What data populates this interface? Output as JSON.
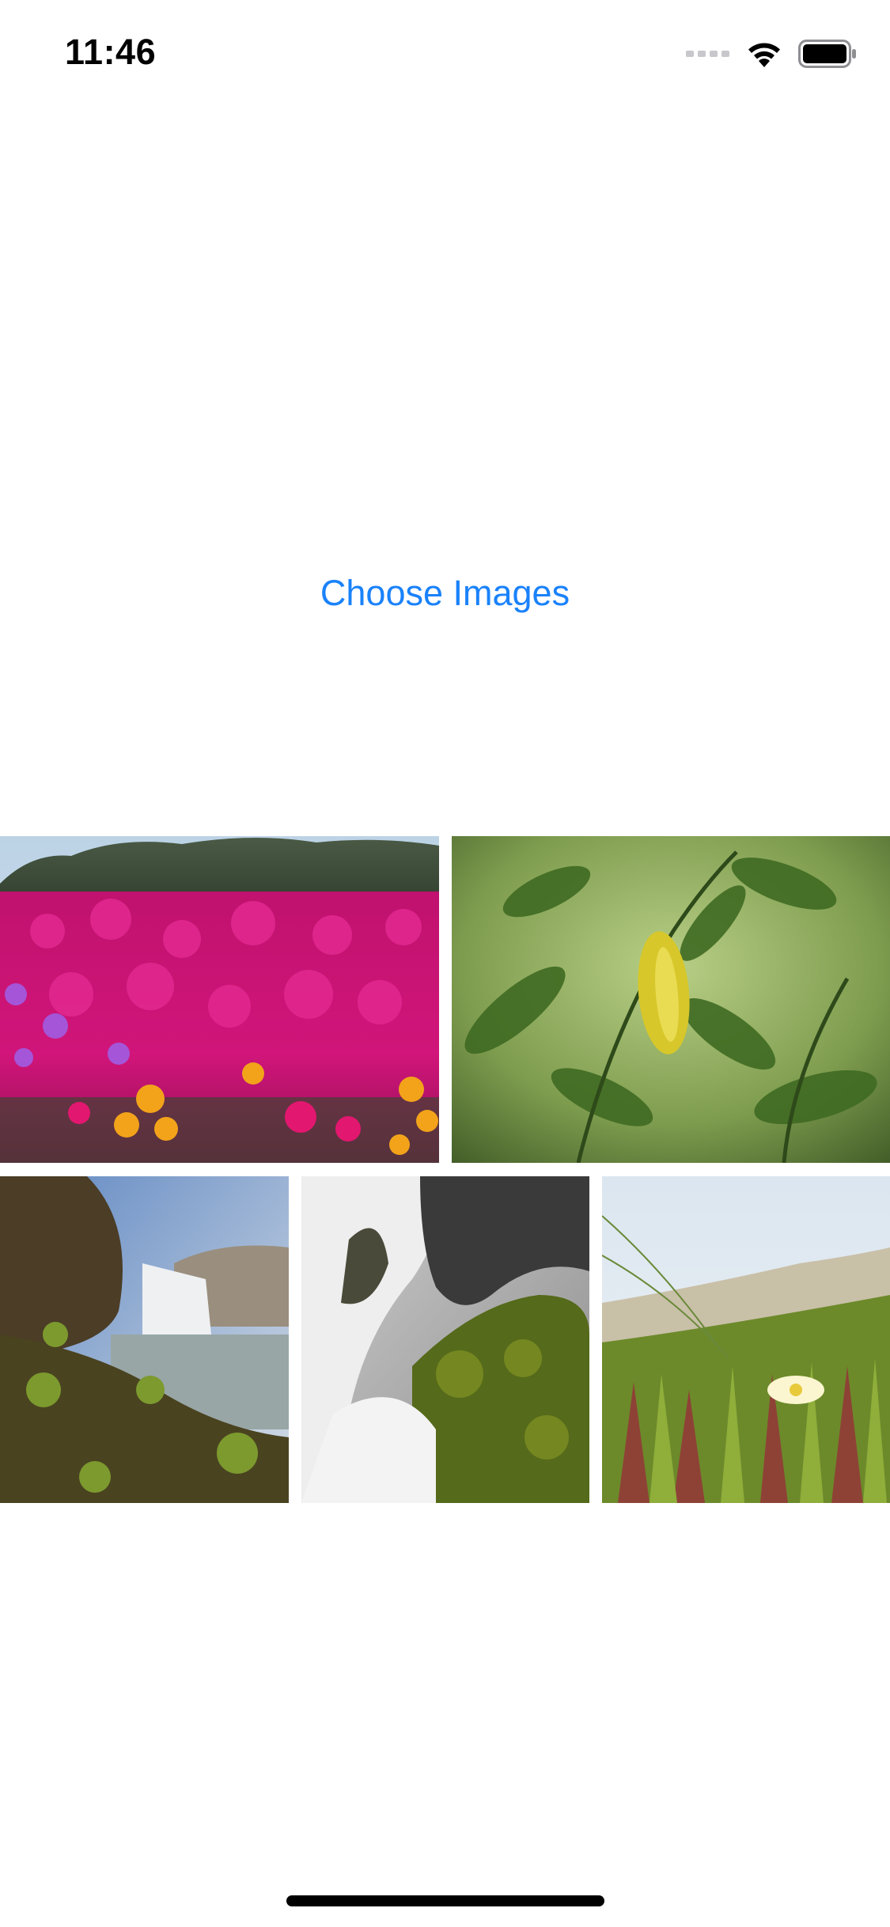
{
  "status_bar": {
    "time": "11:46",
    "icons": [
      "signal-icon",
      "wifi-icon",
      "battery-icon"
    ]
  },
  "main": {
    "choose_button_label": "Choose Images",
    "accent_color": "#1a82fb"
  },
  "gallery": {
    "rows": [
      [
        {
          "name": "photo-pink-flowers",
          "subject": "pink-flower-meadow"
        },
        {
          "name": "photo-green-leaves",
          "subject": "green-leaves-yellow-leaf"
        }
      ],
      [
        {
          "name": "photo-waterfall-cliff",
          "subject": "waterfall-cliff"
        },
        {
          "name": "photo-waterfall-moss",
          "subject": "waterfall-mossy-rocks"
        },
        {
          "name": "photo-ice-plant-flower",
          "subject": "ice-plant-white-flower"
        }
      ]
    ]
  }
}
